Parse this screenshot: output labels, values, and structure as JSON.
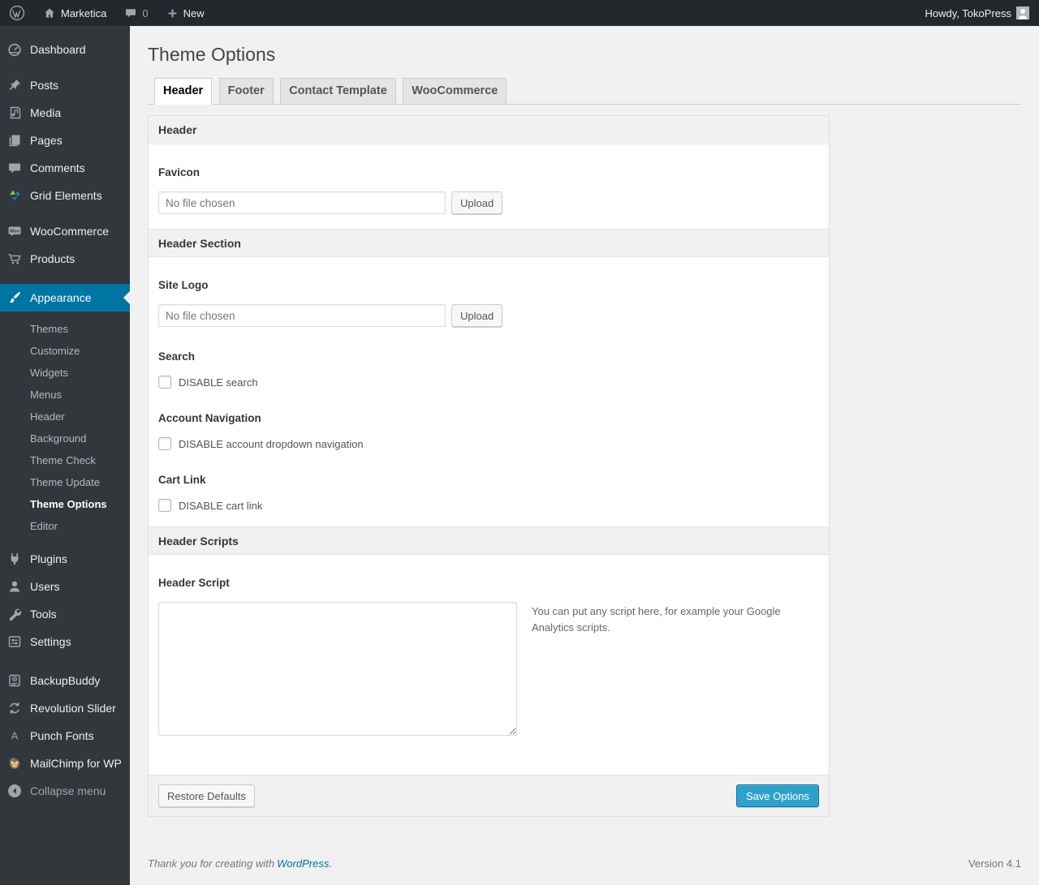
{
  "admin_bar": {
    "site_name": "Marketica",
    "comment_count": "0",
    "new_label": "New",
    "howdy_label": "Howdy, TokoPress"
  },
  "sidebar": {
    "items": {
      "dashboard": "Dashboard",
      "posts": "Posts",
      "media": "Media",
      "pages": "Pages",
      "comments": "Comments",
      "grid_elements": "Grid Elements",
      "woocommerce": "WooCommerce",
      "products": "Products",
      "appearance": "Appearance",
      "plugins": "Plugins",
      "users": "Users",
      "tools": "Tools",
      "settings": "Settings",
      "backupbuddy": "BackupBuddy",
      "revolution_slider": "Revolution Slider",
      "punch_fonts": "Punch Fonts",
      "mailchimp": "MailChimp for WP",
      "collapse": "Collapse menu"
    },
    "appearance_submenu": [
      "Themes",
      "Customize",
      "Widgets",
      "Menus",
      "Header",
      "Background",
      "Theme Check",
      "Theme Update",
      "Theme Options",
      "Editor"
    ],
    "current_item": "Appearance",
    "current_submenu_item": "Theme Options"
  },
  "page": {
    "title": "Theme Options",
    "tabs": [
      {
        "label": "Header",
        "active": true
      },
      {
        "label": "Footer",
        "active": false
      },
      {
        "label": "Contact Template",
        "active": false
      },
      {
        "label": "WooCommerce",
        "active": false
      }
    ]
  },
  "panel": {
    "sections": {
      "header": "Header",
      "header_section": "Header Section",
      "header_scripts": "Header Scripts"
    },
    "favicon": {
      "label": "Favicon",
      "file_value": "No file chosen",
      "upload_label": "Upload"
    },
    "site_logo": {
      "label": "Site Logo",
      "file_value": "No file chosen",
      "upload_label": "Upload"
    },
    "search": {
      "label": "Search",
      "checkbox_label": "DISABLE search",
      "checked": false
    },
    "account_navigation": {
      "label": "Account Navigation",
      "checkbox_label": "DISABLE account dropdown navigation",
      "checked": false
    },
    "cart_link": {
      "label": "Cart Link",
      "checkbox_label": "DISABLE cart link",
      "checked": false
    },
    "header_script": {
      "label": "Header Script",
      "value": "",
      "help": "You can put any script here, for example your Google Analytics scripts."
    },
    "actions": {
      "restore_label": "Restore Defaults",
      "save_label": "Save Options"
    }
  },
  "footer": {
    "thanks_text": "Thank you for creating with",
    "wordpress_link": "WordPress.",
    "version": "Version 4.1"
  },
  "colors": {
    "admin_bar_bg": "#23282d",
    "sidebar_bg": "#32373c",
    "menu_highlight": "#0074a2",
    "primary_button": "#2ea2cc",
    "link_blue": "#0074a2"
  }
}
